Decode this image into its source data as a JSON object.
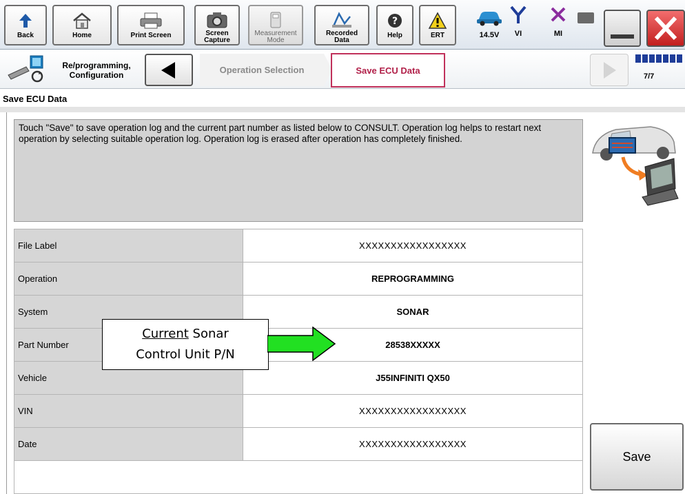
{
  "toolbar": {
    "back_label": "Back",
    "home_label": "Home",
    "print_label": "Print Screen",
    "capture_label_1": "Screen",
    "capture_label_2": "Capture",
    "measure_label_1": "Measurement",
    "measure_label_2": "Mode",
    "recorded_label_1": "Recorded",
    "recorded_label_2": "Data",
    "help_label": "Help",
    "ert_label": "ERT",
    "voltage": "14.5V",
    "vi_label": "VI",
    "mi_label": "MI"
  },
  "breadcrumb": {
    "section_line1": "Re/programming,",
    "section_line2": "Configuration",
    "step_prev": "Operation Selection",
    "step_current": "Save ECU Data",
    "progress": "7/7",
    "progress_fraction": 1.0
  },
  "page": {
    "title": "Save ECU Data",
    "instructions": "Touch \"Save\" to save operation log and the current part number as listed below to CONSULT. Operation log helps to restart next operation by selecting suitable operation log. Operation log is erased after operation has completely finished."
  },
  "table": {
    "rows": [
      {
        "label": "File Label",
        "value": "XXXXXXXXXXXXXXXXX"
      },
      {
        "label": "Operation",
        "value": "REPROGRAMMING"
      },
      {
        "label": "System",
        "value": "SONAR"
      },
      {
        "label": "Part Number",
        "value": "28538XXXXX"
      },
      {
        "label": "Vehicle",
        "value": "J55INFINITI QX50"
      },
      {
        "label": "VIN",
        "value": "XXXXXXXXXXXXXXXXX"
      },
      {
        "label": "Date",
        "value": "XXXXXXXXXXXXXXXXX"
      }
    ]
  },
  "callout": {
    "line1_underlined": "Current",
    "line1_rest": " Sonar",
    "line2": "Control Unit P/N"
  },
  "save_label": "Save",
  "colors": {
    "accent_current_step": "#c0305a",
    "arrow": "#22e022",
    "progress": "#1f3d99"
  }
}
